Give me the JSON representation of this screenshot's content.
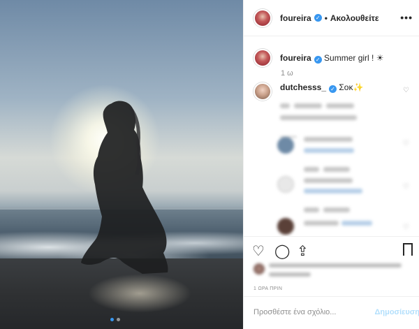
{
  "header": {
    "username": "foureira",
    "separator": "•",
    "follow_status": "Ακολουθείτε",
    "more": "•••"
  },
  "caption": {
    "username": "foureira",
    "text": "Summer girl ! ☀",
    "time_ago": "1 ω"
  },
  "comment": {
    "username": "dutchesss_",
    "text": "Σοκ✨"
  },
  "actions": {
    "timestamp": "1 ΩΡΑ ΠΡΙΝ"
  },
  "add_comment": {
    "placeholder": "Προσθέστε ένα σχόλιο...",
    "post_label": "Δημοσίευση"
  },
  "icons": {
    "verified": "✓",
    "heart": "♡",
    "comment": "◯",
    "share": "⇪"
  },
  "colors": {
    "accent": "#3897f0",
    "text": "#262626",
    "muted": "#8e8e8e"
  }
}
